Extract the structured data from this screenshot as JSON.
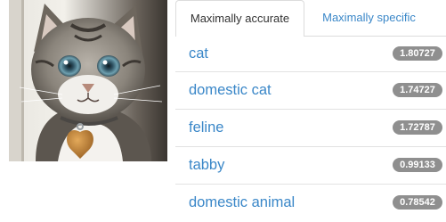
{
  "tabs": {
    "accurate_label": "Maximally accurate",
    "specific_label": "Maximally specific"
  },
  "results": [
    {
      "label": "cat",
      "score": "1.80727"
    },
    {
      "label": "domestic cat",
      "score": "1.74727"
    },
    {
      "label": "feline",
      "score": "1.72787"
    },
    {
      "label": "tabby",
      "score": "0.99133"
    },
    {
      "label": "domestic animal",
      "score": "0.78542"
    }
  ],
  "colors": {
    "link": "#3a87c8",
    "badge": "#8f8f8f",
    "border": "#dcdcdc"
  }
}
